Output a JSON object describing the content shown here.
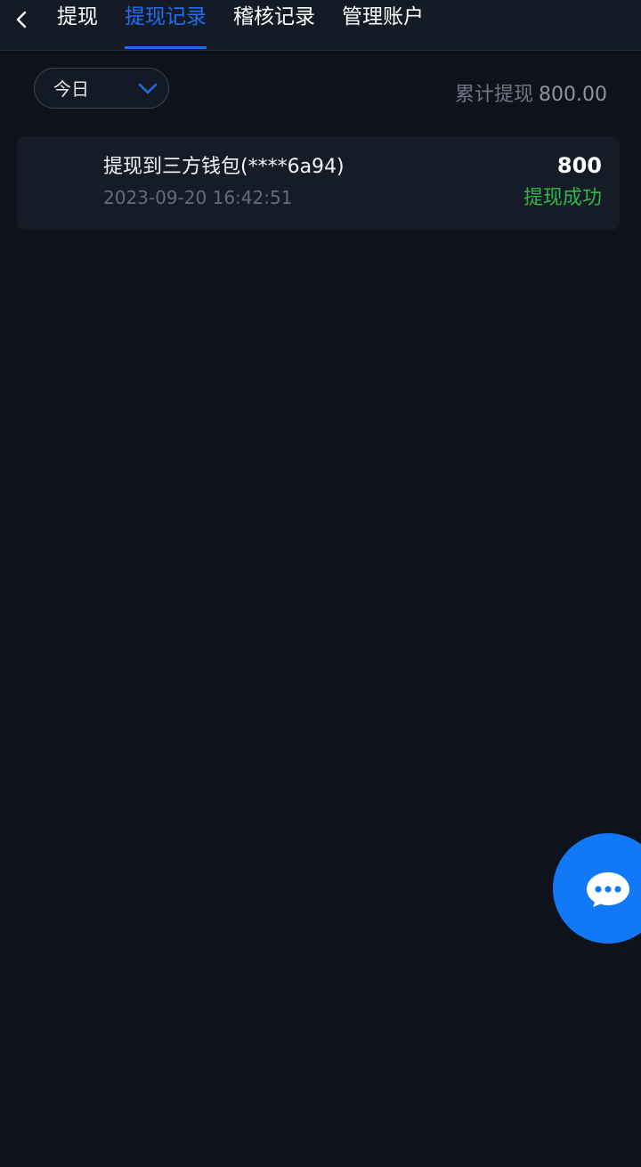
{
  "nav": {
    "back_icon": "chevron-left-icon",
    "tabs": [
      {
        "label": "提现",
        "active": false
      },
      {
        "label": "提现记录",
        "active": true
      },
      {
        "label": "稽核记录",
        "active": false
      },
      {
        "label": "管理账户",
        "active": false
      }
    ]
  },
  "filter": {
    "selected": "今日",
    "icon": "chevron-down-icon"
  },
  "summary": {
    "label": "累计提现",
    "value": "800.00"
  },
  "records": [
    {
      "title": "提现到三方钱包(****6a94)",
      "time": "2023-09-20 16:42:51",
      "amount": "800",
      "status": "提现成功"
    }
  ],
  "chat": {
    "icon": "chat-bubble-icon"
  },
  "colors": {
    "background": "#0e121b",
    "accent": "#1d6ef0",
    "success": "#2fb64a",
    "fab": "#1179f7"
  }
}
